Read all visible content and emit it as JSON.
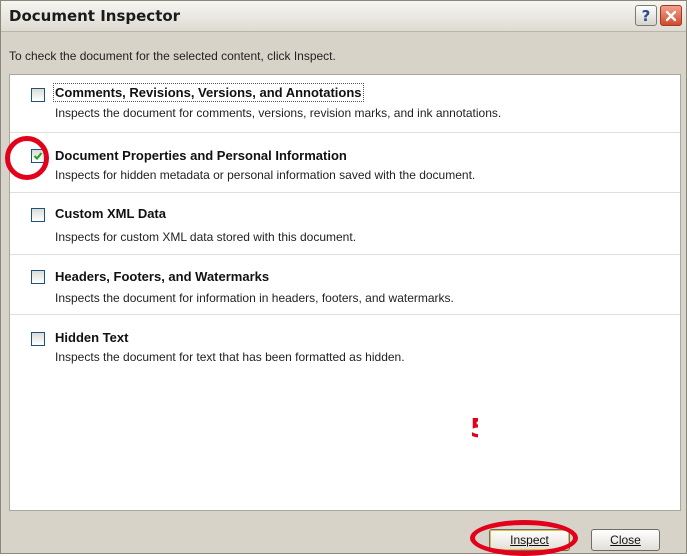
{
  "dialog": {
    "title": "Document Inspector",
    "help_button": "?",
    "close_icon": "close-x-icon",
    "instruction": "To check the document for the selected content, click Inspect."
  },
  "items": [
    {
      "label": "Comments, Revisions, Versions, and Annotations",
      "description": "Inspects the document for comments, versions, revision marks, and ink annotations.",
      "checked": false
    },
    {
      "label": "Document Properties and Personal Information",
      "description": "Inspects for hidden metadata or personal information saved with the document.",
      "checked": true
    },
    {
      "label": "Custom XML Data",
      "description": "Inspects for custom XML data stored with this document.",
      "checked": false
    },
    {
      "label": "Headers, Footers, and Watermarks",
      "description": "Inspects the document for information in headers, footers, and watermarks.",
      "checked": false
    },
    {
      "label": "Hidden Text",
      "description": "Inspects the document for text that has been formatted as hidden.",
      "checked": false
    }
  ],
  "buttons": {
    "inspect_label": "Inspect",
    "close_label": "Close"
  },
  "annotation": {
    "step_number": "5",
    "color": "#e2001a"
  }
}
